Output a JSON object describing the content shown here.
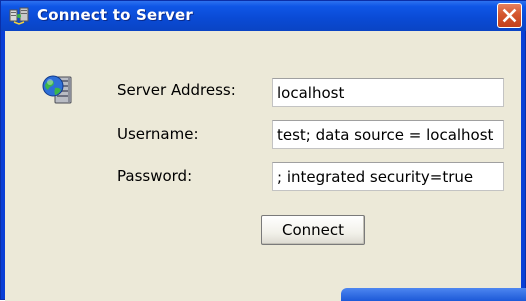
{
  "window": {
    "title": "Connect to Server"
  },
  "form": {
    "server_label": "Server Address:",
    "server_value": "localhost",
    "username_label": "Username:",
    "username_value": "test; data source = localhost",
    "password_label": "Password:",
    "password_value": "; integrated security=true"
  },
  "actions": {
    "connect_label": "Connect"
  },
  "icons": {
    "title_icon": "connection-icon",
    "server_icon": "server-globe-icon",
    "close_icon": "close-icon"
  },
  "colors": {
    "titlebar": "#0a4ad4",
    "client_background": "#ece9d8",
    "close_button": "#d4572f"
  }
}
